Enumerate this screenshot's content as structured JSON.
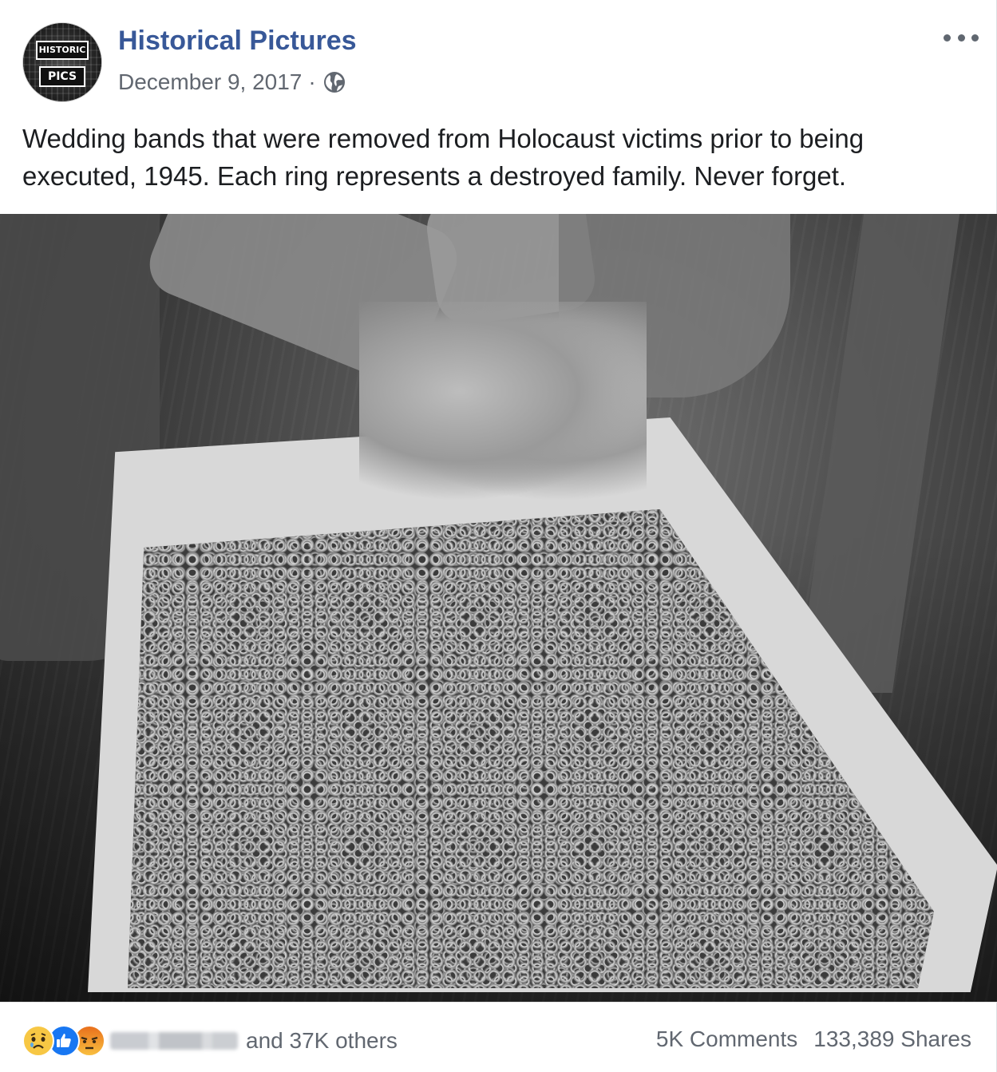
{
  "post": {
    "page_name": "Historical Pictures",
    "avatar": {
      "line1": "HISTORIC",
      "line2": "PICS"
    },
    "date": "December 9, 2017",
    "separator": "·",
    "privacy_icon": "globe-icon",
    "more_icon": "more-options-icon",
    "caption": "Wedding bands that were removed from Holocaust victims prior to being executed, 1945. Each ring represents a destroyed family. Never forget.",
    "photo_alt": "Black and white photograph of hands holding wedding rings above a wooden tray full of rings"
  },
  "footer": {
    "reaction_icons": [
      "sad-reaction-icon",
      "like-reaction-icon",
      "angry-reaction-icon"
    ],
    "others_text": "and 37K others",
    "comments": "5K Comments",
    "shares": "133,389 Shares"
  },
  "colors": {
    "page_name": "#385898",
    "meta_text": "#616770",
    "like": "#1877f2"
  }
}
